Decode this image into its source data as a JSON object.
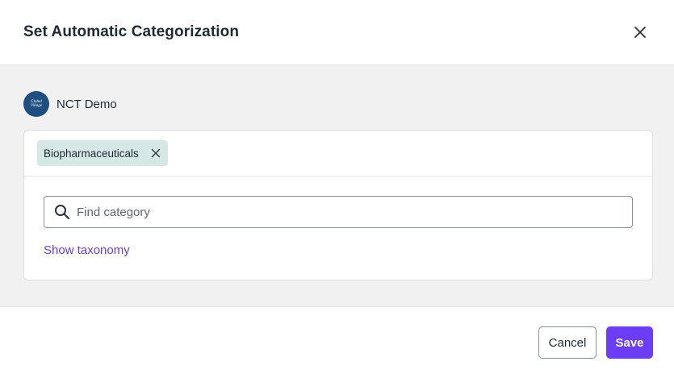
{
  "dialog": {
    "title": "Set Automatic Categorization"
  },
  "organization": {
    "name": "NCT Demo",
    "avatar_text": "Global Village",
    "avatar_color": "#1f4f7f"
  },
  "selected_categories": [
    {
      "label": "Biopharmaceuticals"
    }
  ],
  "search": {
    "placeholder": "Find category",
    "value": ""
  },
  "links": {
    "show_taxonomy": "Show taxonomy"
  },
  "footer": {
    "cancel_label": "Cancel",
    "save_label": "Save"
  },
  "colors": {
    "accent": "#6b3ef5",
    "link": "#6a3fd8",
    "chip_background": "#d6e8e6",
    "body_background": "#f1f1f2"
  }
}
